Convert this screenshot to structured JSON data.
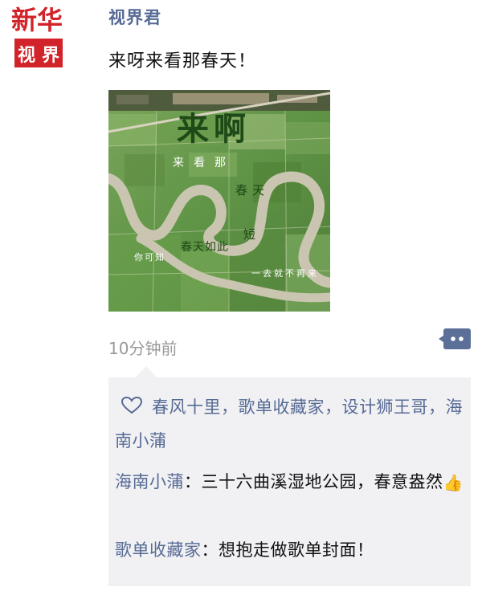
{
  "avatar": {
    "line1": "新华",
    "line2": "视界",
    "color": "#d2232a"
  },
  "post": {
    "username": "视界君",
    "text": "来呀来看那春天！",
    "timestamp": "10分钟前",
    "image": {
      "title": "来啊",
      "phrase1": "来看那",
      "phrase2": "春天",
      "phrase3": "你可知",
      "phrase4": "春天如此",
      "phrase5": "短",
      "phrase6": "一去就不再来",
      "colors": {
        "field": "#5f9446",
        "river": "#c9c5b0",
        "title": "#1e4a17"
      }
    }
  },
  "interactions": {
    "likes": [
      "春风十里",
      "歌单收藏家",
      "设计狮王哥",
      "海南小蒲"
    ],
    "like_separator": "，",
    "comments": [
      {
        "author": "海南小蒲",
        "separator": "：",
        "text": "三十六曲溪湿地公园，春意盎然",
        "emoji": "👍"
      },
      {
        "author": "歌单收藏家",
        "separator": "：",
        "text": "想抱走做歌单封面！"
      }
    ]
  },
  "colors": {
    "link": "#576b95",
    "text": "#111111",
    "timestamp": "#9a9a9a",
    "panel": "#f1f1f4"
  },
  "icons": {
    "heart": "heart-outline-icon",
    "more": "comment-dots-icon"
  }
}
